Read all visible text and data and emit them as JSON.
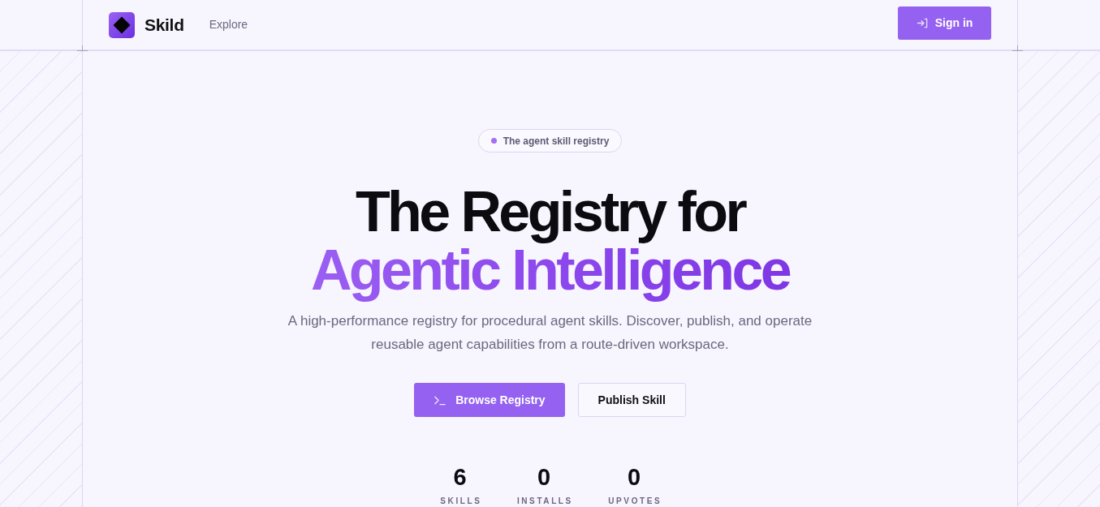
{
  "header": {
    "brand": "Skild",
    "nav": [
      {
        "label": "Explore"
      }
    ],
    "sign_in": "Sign in"
  },
  "hero": {
    "badge": "The agent skill registry",
    "title": "The Registry for",
    "title_highlight": "Agentic Intelligence",
    "description": "A high-performance registry for procedural agent skills. Discover, publish, and operate reusable agent capabilities from a route-driven workspace.",
    "buttons": [
      {
        "label": "Browse Registry",
        "kind": "primary"
      },
      {
        "label": "Publish Skill",
        "kind": "secondary"
      }
    ]
  },
  "stats": [
    {
      "value": "6",
      "label": "SKILLS"
    },
    {
      "value": "0",
      "label": "INSTALLS"
    },
    {
      "value": "0",
      "label": "UPVOTES"
    }
  ]
}
